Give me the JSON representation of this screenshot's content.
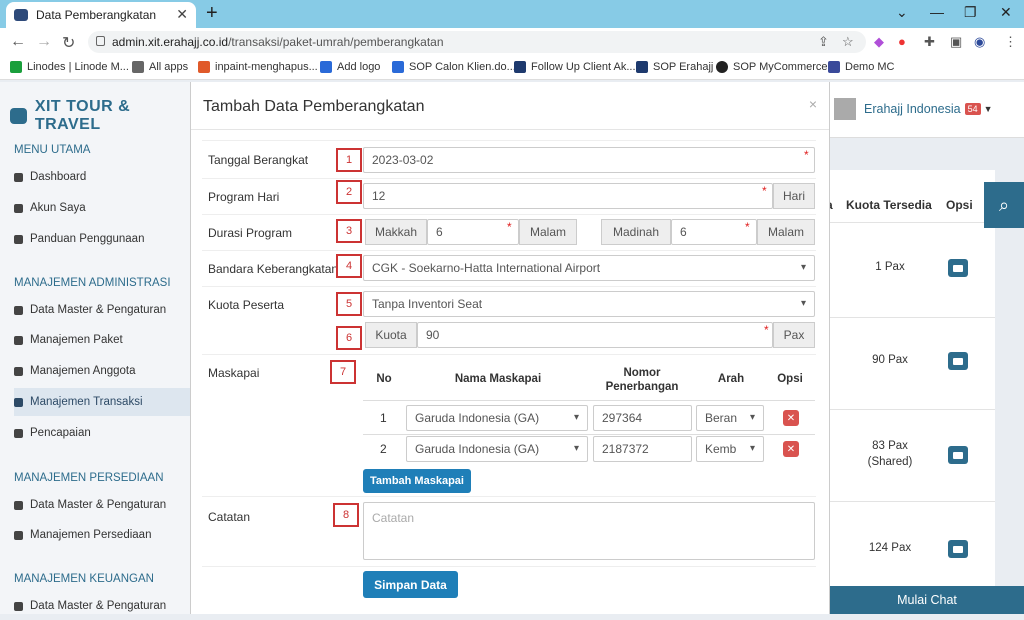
{
  "browser": {
    "tab_title": "Data Pemberangkatan",
    "url_domain": "admin.xit.erahajj.co.id",
    "url_path": "/transaksi/paket-umrah/pemberangkatan",
    "bookmarks": [
      "Linodes | Linode M...",
      "All apps",
      "inpaint-menghapus...",
      "Add logo",
      "SOP Calon Klien.do...",
      "Follow Up Client Ak...",
      "SOP Erahajj",
      "SOP MyCommerce",
      "Demo MC"
    ]
  },
  "sidebar": {
    "brand": "XIT TOUR & TRAVEL",
    "sections": [
      {
        "title": "MENU UTAMA",
        "items": [
          "Dashboard",
          "Akun Saya",
          "Panduan Penggunaan"
        ]
      },
      {
        "title": "MANAJEMEN ADMINISTRASI",
        "items": [
          "Data Master & Pengaturan",
          "Manajemen Paket",
          "Manajemen Anggota",
          "Manajemen Transaksi",
          "Pencapaian"
        ]
      },
      {
        "title": "MANAJEMEN PERSEDIAAN",
        "items": [
          "Data Master & Pengaturan",
          "Manajemen Persediaan"
        ]
      },
      {
        "title": "MANAJEMEN KEUANGAN",
        "items": [
          "Data Master & Pengaturan"
        ]
      }
    ]
  },
  "header": {
    "user_name": "Erahajj Indonesia",
    "badge": "54"
  },
  "background_table": {
    "col_a_partial": "a",
    "col_kuota": "Kuota Tersedia",
    "col_opsi": "Opsi",
    "rows": [
      {
        "kuota": "1 Pax"
      },
      {
        "kuota": "90 Pax"
      },
      {
        "kuota": "83 Pax",
        "note": "(Shared)"
      },
      {
        "kuota": "124 Pax"
      }
    ],
    "chat": "Mulai Chat"
  },
  "modal": {
    "title": "Tambah Data Pemberangkatan",
    "close": "×",
    "fields": {
      "tanggal_label": "Tanggal Berangkat",
      "tanggal_value": "2023-03-02",
      "program_label": "Program Hari",
      "program_value": "12",
      "program_unit": "Hari",
      "durasi_label": "Durasi Program",
      "makkah_label": "Makkah",
      "makkah_value": "6",
      "madinah_label": "Madinah",
      "madinah_value": "6",
      "malam": "Malam",
      "bandara_label": "Bandara Keberangkatan",
      "bandara_value": "CGK - Soekarno-Hatta International Airport",
      "kuota_label": "Kuota Peserta",
      "kuota_select": "Tanpa Inventori Seat",
      "kuota_addon": "Kuota",
      "kuota_value": "90",
      "kuota_unit": "Pax",
      "maskapai_label": "Maskapai",
      "catatan_label": "Catatan",
      "catatan_placeholder": "Catatan",
      "required_mark": "*"
    },
    "maskapai_table": {
      "headers": [
        "No",
        "Nama Maskapai",
        "Nomor Penerbangan",
        "Arah",
        "Opsi"
      ],
      "rows": [
        {
          "no": "1",
          "maskapai": "Garuda Indonesia (GA)",
          "nomor": "297364",
          "arah": "Beran"
        },
        {
          "no": "2",
          "maskapai": "Garuda Indonesia (GA)",
          "nomor": "2187372",
          "arah": "Kemb"
        }
      ],
      "add_button": "Tambah Maskapai"
    },
    "save_button": "Simpan Data",
    "markers": [
      "1",
      "2",
      "3",
      "4",
      "5",
      "6",
      "7",
      "8"
    ]
  }
}
